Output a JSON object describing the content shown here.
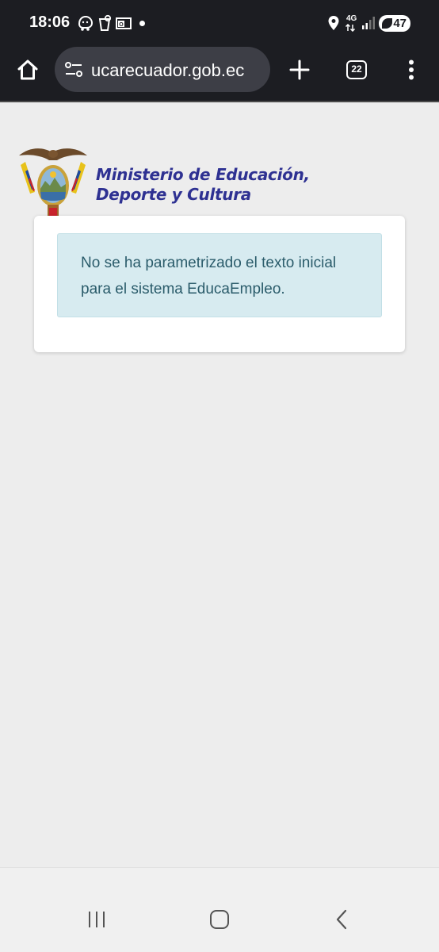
{
  "status_bar": {
    "time": "18:06",
    "network": "4G",
    "battery": "47",
    "icons": [
      "waze-icon",
      "cup-icon",
      "outlook-icon",
      "location-icon",
      "signal-icon"
    ]
  },
  "browser": {
    "url": "ucarecuador.gob.ec",
    "tab_count": "22",
    "icons": [
      "home-icon",
      "site-settings-icon",
      "new-tab-icon",
      "tab-switcher-icon",
      "menu-icon"
    ]
  },
  "page": {
    "ministry_line1": "Ministerio de Educación,",
    "ministry_line2": "Deporte y Cultura",
    "alert_message": "No se ha parametrizado el texto inicial para el sistema EducaEmpleo."
  },
  "colors": {
    "status_bar_bg": "#1c1d22",
    "ministry_text": "#2e3192",
    "alert_bg": "#d7ebf0",
    "alert_text": "#2b5c6b",
    "page_bg": "#ededed"
  },
  "nav_bar": {
    "icons": [
      "recents-icon",
      "home-nav-icon",
      "back-icon"
    ]
  }
}
